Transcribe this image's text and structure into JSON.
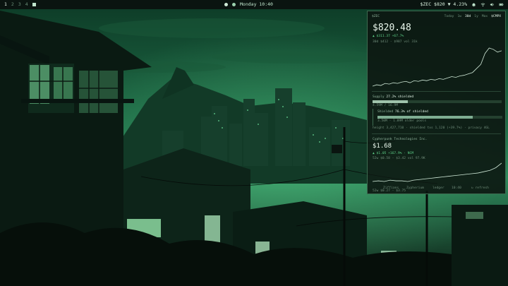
{
  "topbar": {
    "workspaces": [
      "1",
      "2",
      "3",
      "4"
    ],
    "active_workspace": "1",
    "clock": "Monday 10:40",
    "ticker": "$ZEC $820 ▼ 4.23%",
    "tray_icons": [
      "bell-icon",
      "wifi-icon",
      "volume-icon",
      "battery-icon"
    ]
  },
  "widget": {
    "symbol": "$ZEC",
    "tabs": [
      "Today",
      "1w",
      "30d",
      "1y",
      "Max"
    ],
    "selected_tab": "30d",
    "unit": "$CMPX",
    "price": "$820.48",
    "delta": "▲ $311.37  +67.7%",
    "range": "30d $412 - $987   vol 31k",
    "chart": {
      "type": "line",
      "values": [
        40,
        42,
        41,
        44,
        43,
        45,
        44,
        46,
        47,
        45,
        48,
        47,
        49,
        48,
        50,
        49,
        51,
        50,
        52,
        54,
        53,
        55,
        56,
        58,
        60,
        66,
        72,
        88,
        96,
        94,
        90,
        92
      ]
    },
    "supply": {
      "label": "Supply",
      "value": "27.2% shielded",
      "fraction": 0.272,
      "nums": "4.59M / 16.9M"
    },
    "shielded": {
      "label": "Shielded",
      "value": "76.3% of shielded",
      "fraction": 0.763,
      "nums": "3.50M  ·  1.09M older pools"
    },
    "meta": "height 3,427,710  ·  shielded txs 1,120 (+39.7%)  ·  privacy 4GL",
    "company": {
      "name": "Cypherpunk Technologies Inc.",
      "price": "$1.68",
      "delta": "▲ $1.05  +167.9%  ·  NCM",
      "range": "52w $0.58 - $3.42   vol 97.9K",
      "chart": {
        "type": "line",
        "values": [
          12,
          13,
          12,
          14,
          13,
          13,
          12,
          14,
          15,
          16,
          17,
          18,
          19,
          20,
          21,
          22,
          23,
          24,
          25,
          27,
          29,
          33,
          40
        ]
      },
      "low": "52w $0.27 - $3.75"
    },
    "footer": [
      "Ziffians",
      "Zypherium",
      "ledger",
      "10:40",
      "↻ refresh"
    ]
  },
  "colors": {
    "accent": "#5fd38a",
    "line": "#cfe8d7"
  }
}
